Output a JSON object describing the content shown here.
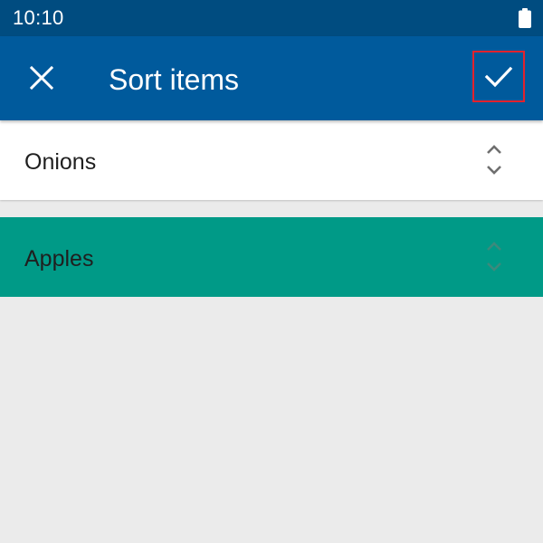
{
  "status_bar": {
    "time": "10:10",
    "battery_icon": "battery-full-icon"
  },
  "app_bar": {
    "title": "Sort items",
    "close_icon": "close-icon",
    "confirm_icon": "check-icon"
  },
  "colors": {
    "status_bar_bg": "#004c80",
    "app_bar_bg": "#005a9c",
    "highlight_bg": "#009a87",
    "background": "#ebebeb",
    "confirm_outline": "#e3222d"
  },
  "items": [
    {
      "label": "Onions",
      "state": "normal"
    },
    {
      "label": "Apples",
      "state": "dragging"
    }
  ]
}
